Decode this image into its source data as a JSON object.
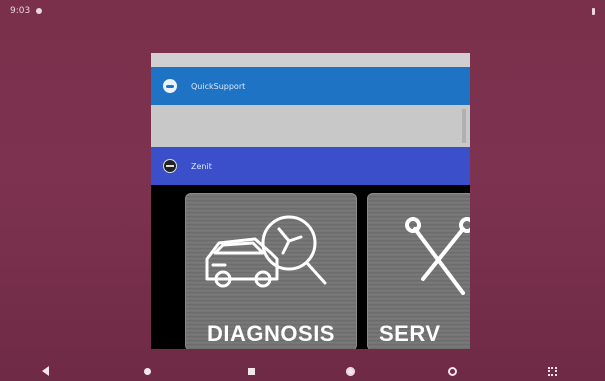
{
  "status_bar": {
    "time": "9:03"
  },
  "recents": {
    "cards": [
      {
        "app_name": "QuickSupport",
        "header_color": "#1f73c4"
      },
      {
        "app_name": "Zenit",
        "header_color": "#3b4fcb"
      }
    ],
    "diagnosis_tiles": [
      {
        "label": "DIAGNOSIS"
      },
      {
        "label": "SERV"
      }
    ]
  },
  "nav_bar": {
    "icons": [
      "back-icon",
      "home-icon",
      "recents-icon",
      "settings-icon",
      "browser-icon",
      "screenshot-icon"
    ]
  },
  "colors": {
    "wallpaper": "#7a2f4a",
    "quicksupport_header": "#1f73c4",
    "zenit_header": "#3b4fcb"
  }
}
